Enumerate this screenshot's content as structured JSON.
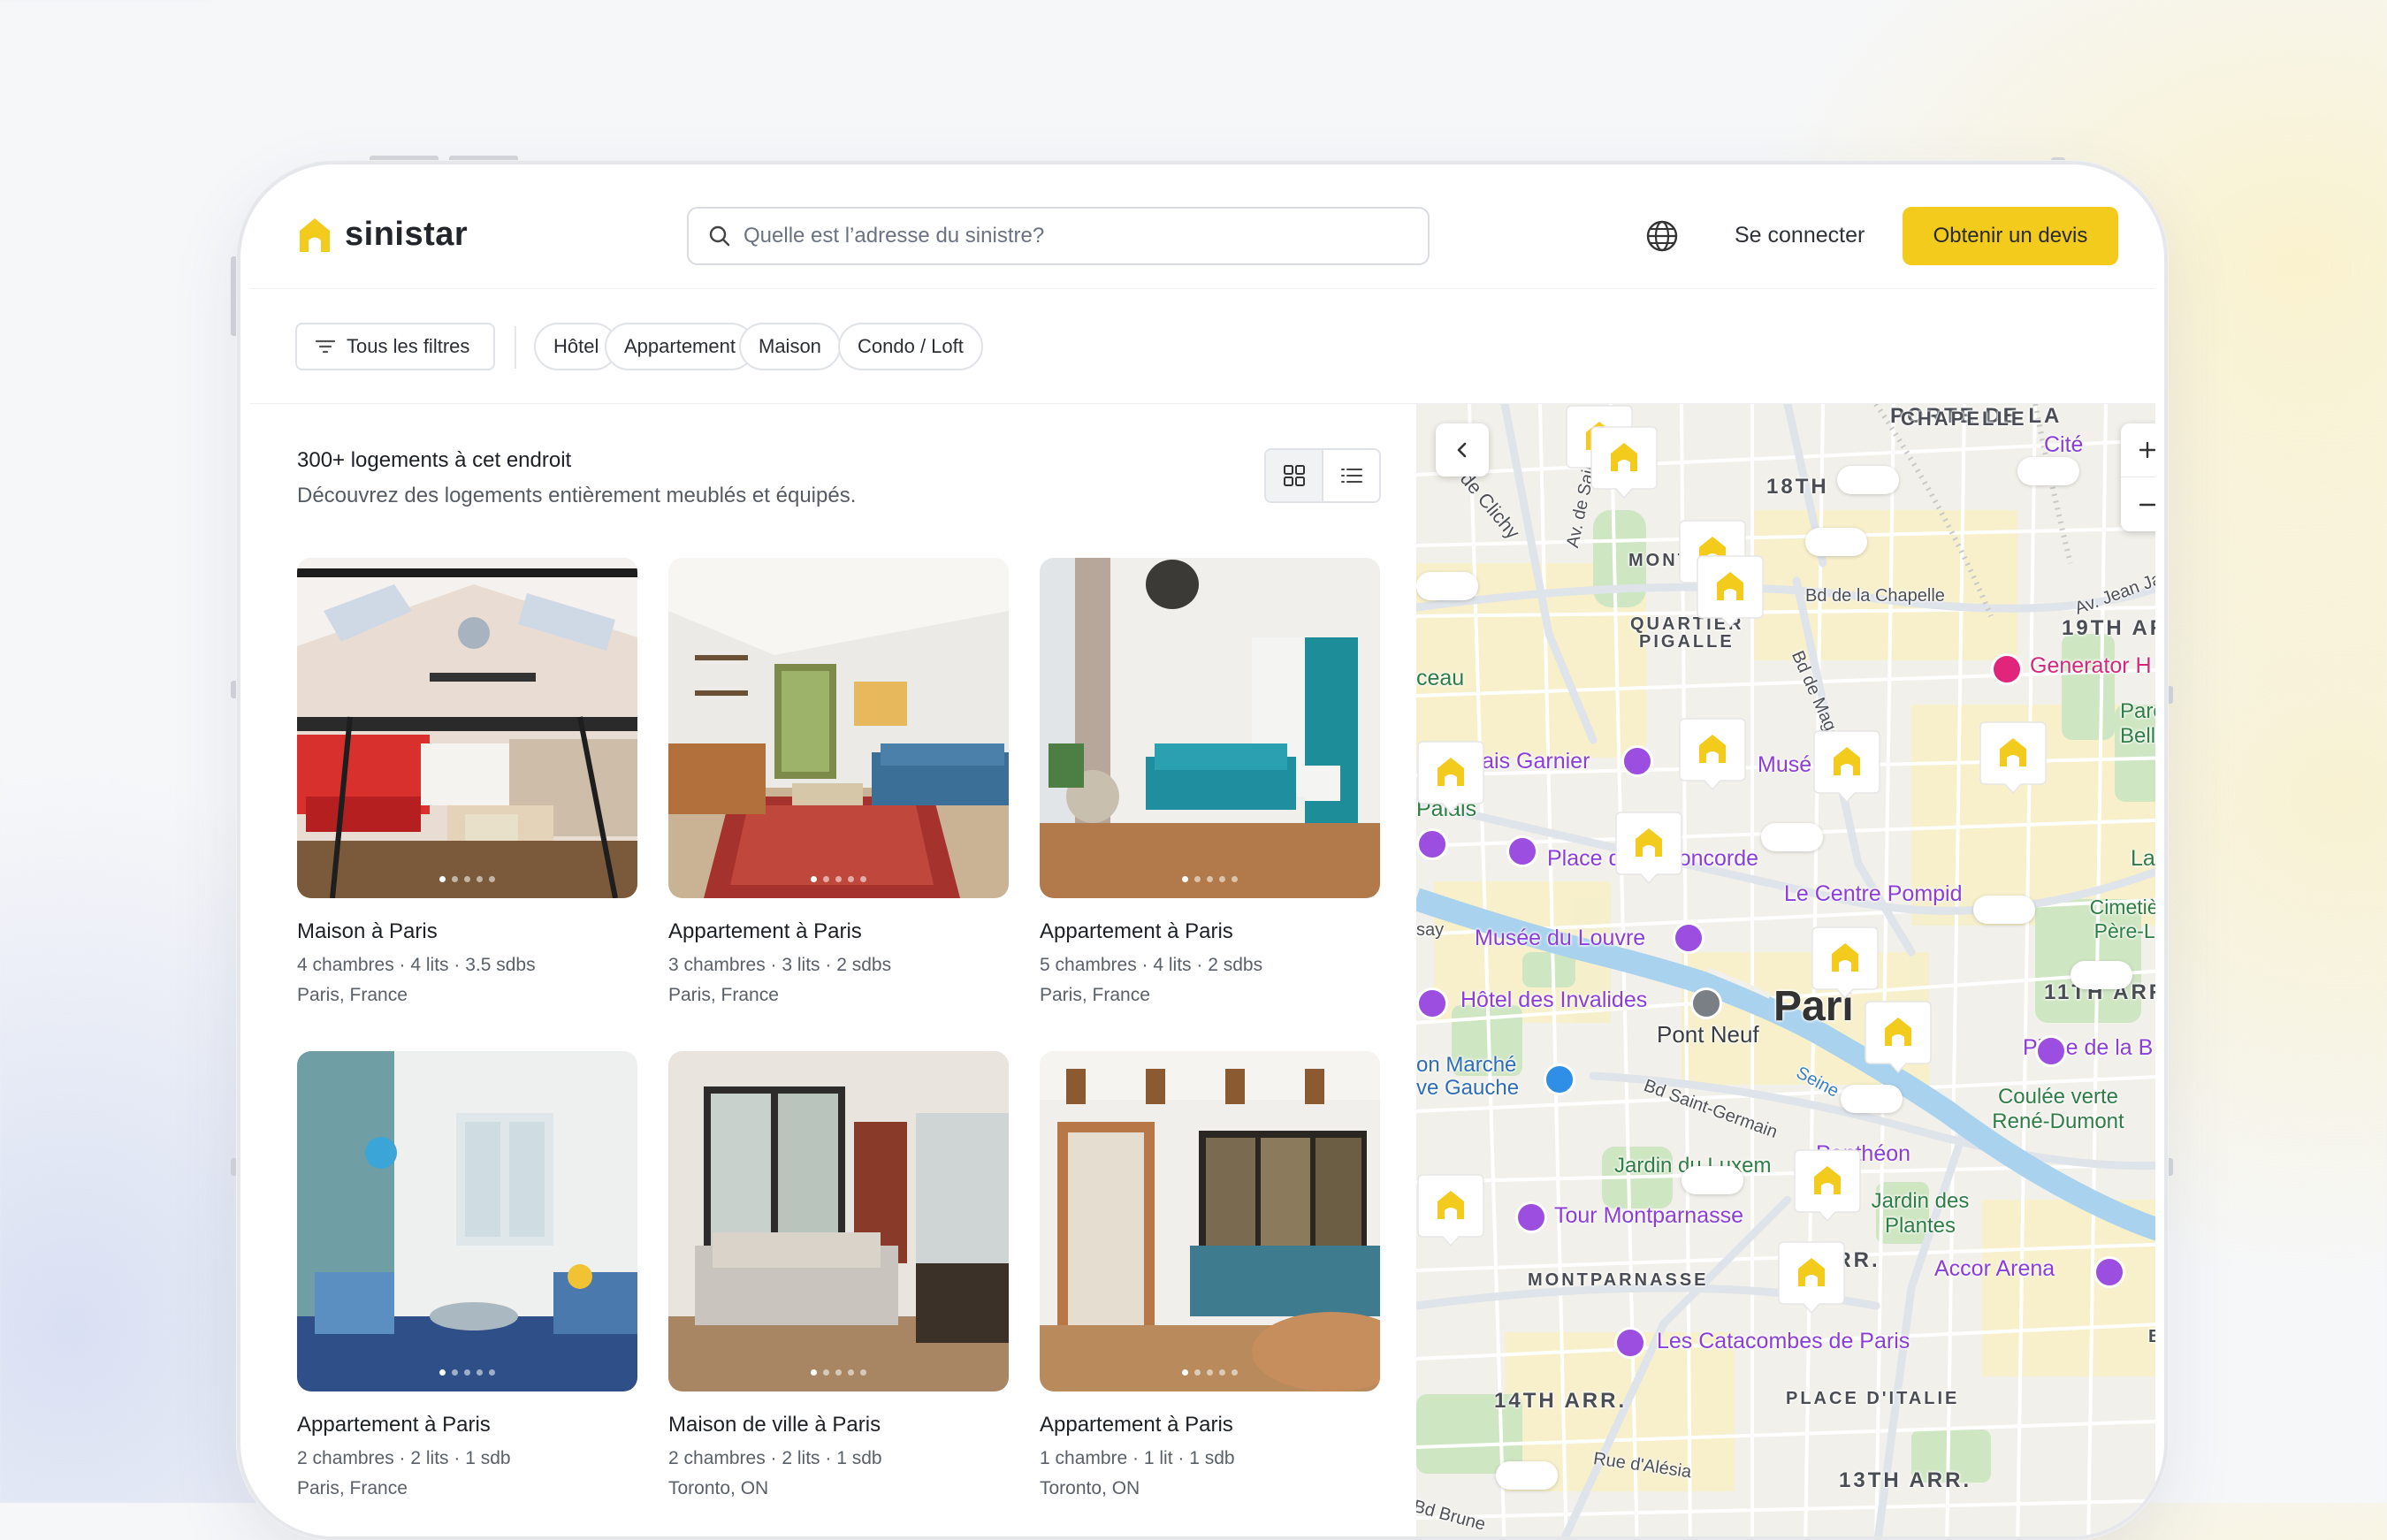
{
  "app": {
    "name": "sinistar"
  },
  "header": {
    "search_placeholder": "Quelle est l’adresse du sinistre?",
    "signin": "Se connecter",
    "cta": "Obtenir un devis"
  },
  "filters": {
    "all": "Tous les filtres",
    "chips": [
      "Hôtel",
      "Appartement",
      "Maison",
      "Condo / Loft"
    ]
  },
  "listings": {
    "count": "300+ logements à cet endroit",
    "subtitle": "Découvrez des logements entièrement meublés et équipés.",
    "items": [
      {
        "title": "Maison à Paris",
        "meta": "4 chambres · 4 lits · 3.5 sdbs",
        "location": "Paris, France"
      },
      {
        "title": "Appartement à Paris",
        "meta": "3 chambres · 3 lits · 2 sdbs",
        "location": "Paris, France"
      },
      {
        "title": "Appartement à Paris",
        "meta": "5 chambres · 4 lits · 2 sdbs",
        "location": "Paris, France"
      },
      {
        "title": "Appartement à Paris",
        "meta": "2 chambres · 2 lits · 1 sdb",
        "location": "Paris, France"
      },
      {
        "title": "Maison de ville à Paris",
        "meta": "2 chambres · 2 lits · 1 sdb",
        "location": "Toronto, ON"
      },
      {
        "title": "Appartement à Paris",
        "meta": "1 chambre · 1 lit · 1 sdb",
        "location": "Toronto, ON"
      }
    ]
  },
  "map": {
    "districts": [
      "18TH",
      "QUARTIER",
      "PIGALLE",
      "19TH AR",
      "11TH ARR",
      "MONTPARNASSE",
      "14TH ARR.",
      "PLACE D'ITALIE",
      "13TH ARR.",
      "CHAPELLE",
      "PORTE DE LA",
      "MONT",
      "ARR.",
      "BE"
    ],
    "city": "Pari",
    "pois": [
      "Palais Garnier",
      "Musée du Louvre",
      "Hôtel des Invalides",
      "Le Centre Pompid",
      "Place de la Concorde",
      "Tour Montparnasse",
      "Les Catacombes de Paris",
      "Accor Arena",
      "Place de la B",
      "Cité",
      "Musé",
      "Panthéon"
    ],
    "pink": [
      "Generator H"
    ],
    "green": [
      "Jardin du Luxem",
      "Jardin des Plantes",
      "Coulée verte René-Dumont",
      "Cimetière Père-Lac",
      "Parc Belle",
      "ceau",
      "Palais",
      "La B",
      "on Marché",
      "ve Gauche",
      "Pont Neuf",
      "Seine"
    ],
    "roads": [
      "Bd de la Chapelle",
      "Bd de Magenta",
      "Av. de Saint-Ouen",
      "de Clichy",
      "Bd Saint-Germain",
      "Rue d'Alésia",
      "Av. Jean Jaurès",
      "Bd Brune",
      "say"
    ]
  },
  "colors": {
    "accent": "#f2cb1d",
    "poi": "#9b4ee0"
  }
}
